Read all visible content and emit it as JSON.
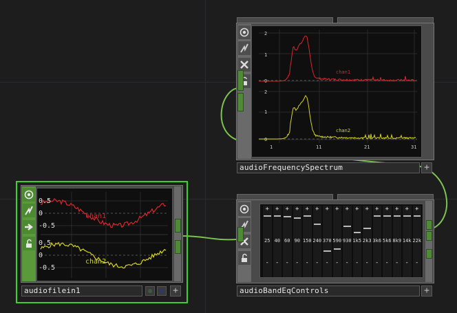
{
  "nodes": {
    "spectrum": {
      "name": "audioFrequencySpectrum",
      "channels": [
        {
          "label": "chan1",
          "color": "#d8262c",
          "ticks": [
            "2",
            "1",
            "0"
          ]
        },
        {
          "label": "chan2",
          "color": "#d6d420",
          "ticks": [
            "2",
            "1",
            "0"
          ]
        }
      ],
      "xticks": [
        "1",
        "11",
        "21",
        "31"
      ],
      "plus": "+"
    },
    "filein": {
      "name": "audiofilein1",
      "channels": [
        {
          "label": "chan1",
          "color": "#d8262c",
          "ticks": [
            "0.5",
            "0",
            "-0.5"
          ]
        },
        {
          "label": "chan2",
          "color": "#d6d420",
          "ticks": [
            "0.5",
            "0",
            "-0.5"
          ]
        }
      ],
      "plus": "+",
      "selected_color": "#3cd22a"
    },
    "eq": {
      "name": "audioBandEqControls",
      "bands": [
        "25",
        "40",
        "60",
        "90",
        "150",
        "240",
        "370",
        "590",
        "930",
        "1k5",
        "2k3",
        "3k6",
        "5k6",
        "8k9",
        "14k",
        "22k"
      ],
      "band_levels": [
        0.0,
        0.0,
        0.02,
        0.05,
        0.0,
        0.2,
        0.85,
        0.8,
        0.25,
        0.4,
        0.3,
        0.0,
        0.0,
        0.0,
        0.0,
        0.0
      ],
      "plus_glyph": "+",
      "minus_glyph": "-",
      "plus": "+"
    }
  },
  "side_icons": [
    "viewer-icon",
    "bypass-icon",
    "cross-icon",
    "lock-icon"
  ],
  "colors": {
    "wire": "#7dc352",
    "connector": "#4f8a37"
  }
}
